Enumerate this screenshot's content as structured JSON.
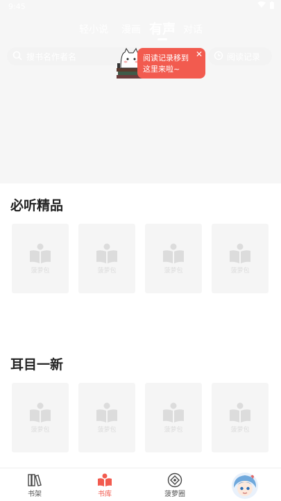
{
  "status_bar": {
    "time": "9:45"
  },
  "tabs": [
    {
      "label": "轻小说"
    },
    {
      "label": "漫画"
    },
    {
      "label": "有声"
    },
    {
      "label": "对话"
    }
  ],
  "search": {
    "placeholder": "搜书名作者名"
  },
  "history": {
    "label": "阅读记录"
  },
  "tooltip": {
    "line1": "阅读记录移到",
    "line2": "这里来啦~",
    "close": "✕"
  },
  "sections": [
    {
      "title": "必听精品"
    },
    {
      "title": "耳目一新"
    }
  ],
  "card_placeholder_label": "菠萝包",
  "bottom_nav": [
    {
      "label": "书架"
    },
    {
      "label": "书库"
    },
    {
      "label": "菠萝圈"
    }
  ],
  "colors": {
    "accent": "#f25b4f",
    "header_bg": "#f6f6f6",
    "card_bg": "#f5f5f5"
  },
  "icons": [
    "search-icon",
    "clock-icon",
    "close-icon",
    "bookshelf-icon",
    "library-icon",
    "circle-icon",
    "avatar"
  ]
}
